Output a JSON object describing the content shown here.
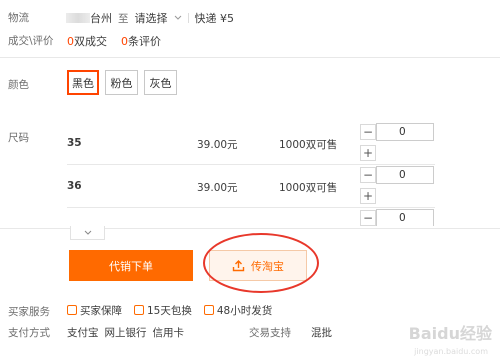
{
  "logistics": {
    "label": "物流",
    "from": "台州",
    "to_word": "至",
    "dest_select": "请选择",
    "express": "快递 ¥5"
  },
  "deals": {
    "label": "成交\\评价",
    "deal_count": "0",
    "deal_unit": "双成交",
    "review_count": "0",
    "review_unit": "条评价"
  },
  "color": {
    "label": "颜色",
    "options": [
      "黑色",
      "粉色",
      "灰色"
    ],
    "selected": "黑色"
  },
  "size": {
    "label": "尺码",
    "rows": [
      {
        "size": "35",
        "price": "39.00元",
        "stock": "1000双可售",
        "qty": "0"
      },
      {
        "size": "36",
        "price": "39.00元",
        "stock": "1000双可售",
        "qty": "0"
      },
      {
        "qty": "0"
      }
    ],
    "minus": "−",
    "plus": "+"
  },
  "actions": {
    "buy_label": "代销下单",
    "share_label": "传淘宝"
  },
  "services": {
    "label": "买家服务",
    "items": [
      "买家保障",
      "15天包换",
      "48小时发货"
    ]
  },
  "payment": {
    "label": "支付方式",
    "methods": [
      "支付宝",
      "网上银行",
      "信用卡"
    ],
    "trade_label": "交易支持",
    "trade_value": "混批"
  },
  "watermark": {
    "text": "Baidu经验",
    "sub": "jingyan.baidu.com"
  },
  "colors": {
    "accent": "#ff6a00",
    "price_orange": "#ff4400",
    "ring_red": "#e8382b"
  }
}
